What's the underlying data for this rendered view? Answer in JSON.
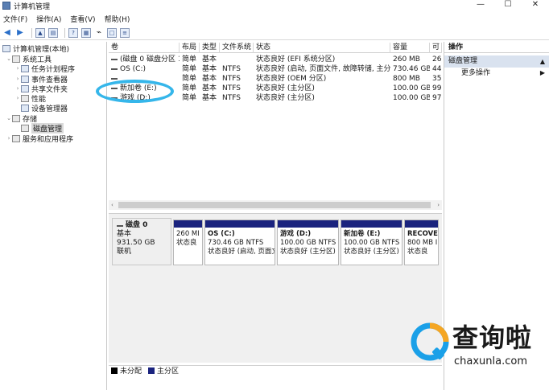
{
  "window": {
    "title": "计算机管理",
    "controls": [
      "—",
      "☐",
      "✕"
    ]
  },
  "menu": [
    "文件(F)",
    "操作(A)",
    "查看(V)",
    "帮助(H)"
  ],
  "tree": {
    "root": "计算机管理(本地)",
    "items": [
      {
        "label": "系统工具"
      },
      {
        "label": "任务计划程序"
      },
      {
        "label": "事件查看器"
      },
      {
        "label": "共享文件夹"
      },
      {
        "label": "性能"
      },
      {
        "label": "设备管理器"
      },
      {
        "label": "存储"
      },
      {
        "label": "磁盘管理"
      },
      {
        "label": "服务和应用程序"
      }
    ]
  },
  "volumes": {
    "columns": [
      "卷",
      "布局",
      "类型",
      "文件系统",
      "状态",
      "容量",
      "可"
    ],
    "rows": [
      [
        "(磁盘 0 磁盘分区 1)",
        "简单",
        "基本",
        "",
        "状态良好 (EFI 系统分区)",
        "260 MB",
        "26"
      ],
      [
        "OS (C:)",
        "简单",
        "基本",
        "NTFS",
        "状态良好 (启动, 页面文件, 故障转储, 主分区)",
        "730.46 GB",
        "44"
      ],
      [
        "",
        "简单",
        "基本",
        "NTFS",
        "状态良好 (OEM 分区)",
        "800 MB",
        "35"
      ],
      [
        "新加卷 (E:)",
        "简单",
        "基本",
        "NTFS",
        "状态良好 (主分区)",
        "100.00 GB",
        "99"
      ],
      [
        "游戏 (D:)",
        "简单",
        "基本",
        "NTFS",
        "状态良好 (主分区)",
        "100.00 GB",
        "97"
      ]
    ]
  },
  "disk": {
    "name": "磁盘 0",
    "type": "基本",
    "size": "931.50 GB",
    "status": "联机",
    "partitions": [
      {
        "name": "",
        "size": "260 MI",
        "status": "状态良"
      },
      {
        "name": "OS (C:)",
        "size": "730.46 GB NTFS",
        "status": "状态良好 (启动, 页面文"
      },
      {
        "name": "游戏 (D:)",
        "size": "100.00 GB NTFS",
        "status": "状态良好 (主分区)"
      },
      {
        "name": "新加卷 (E:)",
        "size": "100.00 GB NTFS",
        "status": "状态良好 (主分区)"
      },
      {
        "name": "RECOVEI",
        "size": "800 MB I",
        "status": "状态良"
      }
    ]
  },
  "legend": {
    "unallocated": "未分配",
    "primary": "主分区"
  },
  "actions": {
    "header": "操作",
    "section": "磁盘管理",
    "more": "更多操作"
  },
  "watermark": {
    "cn": "查询啦",
    "en": "chaxunla.com"
  },
  "colors": {
    "partition_stripe": "#1a237e",
    "highlight_circle": "#35b6ea",
    "selection": "#d9e2ef"
  }
}
